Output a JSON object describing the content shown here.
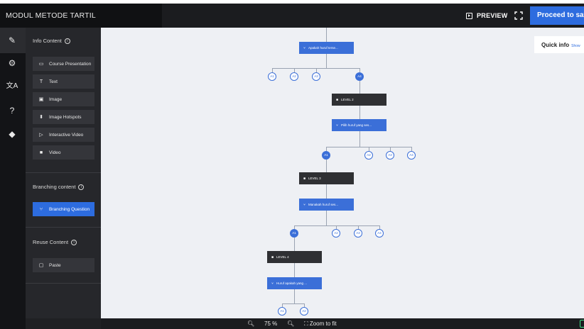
{
  "app": {
    "title": "MODUL METODE TARTIL",
    "preview_label": "PREVIEW",
    "proceed_label": "Proceed to save"
  },
  "sidebar": {
    "info_content_title": "Info Content",
    "info_items": [
      {
        "label": "Course Presentation",
        "icon": "presentation-icon"
      },
      {
        "label": "Text",
        "icon": "text-icon"
      },
      {
        "label": "Image",
        "icon": "image-icon"
      },
      {
        "label": "Image Hotspots",
        "icon": "hotspot-icon"
      },
      {
        "label": "Interactive Video",
        "icon": "interactive-video-icon"
      },
      {
        "label": "Video",
        "icon": "video-icon"
      }
    ],
    "branching_title": "Branching content",
    "branching_item": "Branching Question",
    "reuse_title": "Reuse Content",
    "reuse_item": "Paste"
  },
  "quick_info": {
    "label": "Quick info",
    "link": "Show"
  },
  "tree": {
    "q1": "Apakah huruf terse...",
    "level2": "LEVEL 2",
    "q2": "Pilih huruf yang ses...",
    "level3": "LEVEL 3",
    "q3": "Manakah huruf ses...",
    "level4": "LEVEL 4",
    "q4": "Huruf apakah yang ...",
    "row1": [
      "A1",
      "A2",
      "A3",
      "A4"
    ],
    "row2": [
      "A1",
      "A2",
      "A3",
      "A4"
    ],
    "row3": [
      "A1",
      "A2",
      "A3",
      "A4"
    ],
    "row4": [
      "A1",
      "A2"
    ]
  },
  "bottombar": {
    "zoom_value": "75 %",
    "zoom_fit_label": "Zoom to fit"
  },
  "colors": {
    "accent": "#2d6cdf",
    "dark_panel": "#26272b",
    "canvas_bg": "#eef0f4"
  }
}
